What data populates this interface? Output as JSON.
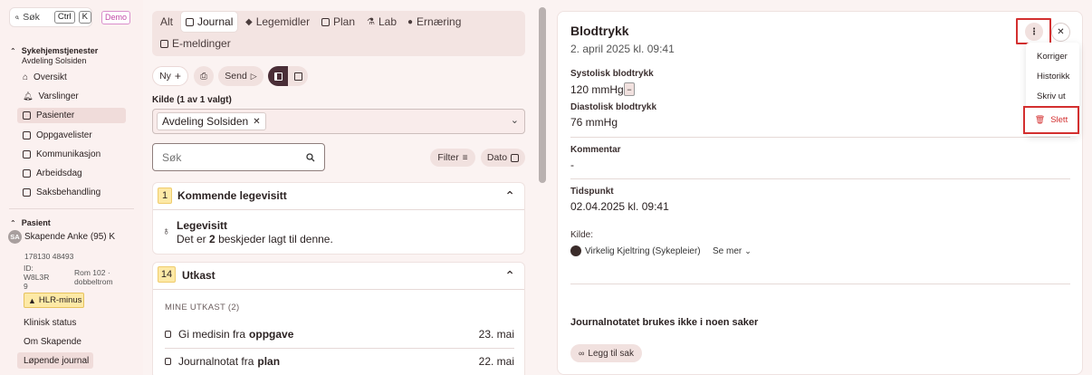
{
  "sidebar": {
    "search_label": "Søk",
    "kbd_ctrl": "Ctrl",
    "kbd_k": "K",
    "demo_badge": "Demo",
    "section_title": "Sykehjemstjenester",
    "section_sub": "Avdeling Solsiden",
    "items": [
      {
        "label": "Oversikt"
      },
      {
        "label": "Varslinger"
      },
      {
        "label": "Pasienter"
      },
      {
        "label": "Oppgavelister"
      },
      {
        "label": "Kommunikasjon"
      },
      {
        "label": "Arbeidsdag"
      },
      {
        "label": "Saksbehandling"
      }
    ],
    "patient": {
      "section_title": "Pasient",
      "initials": "SA",
      "name": "Skapende Anke (95) K",
      "ssn": "178130 48493",
      "id_line1": "ID:",
      "id_line2": "W8L3R",
      "id_line3": "9",
      "room_line1": "Rom 102 ·",
      "room_line2": "dobbeltrom",
      "alert": "HLR-minus",
      "nav": [
        {
          "label": "Klinisk status"
        },
        {
          "label": "Om Skapende"
        },
        {
          "label": "Løpende journal"
        }
      ]
    }
  },
  "tabs": [
    {
      "label": "Alt"
    },
    {
      "label": "Journal"
    },
    {
      "label": "Legemidler"
    },
    {
      "label": "Plan"
    },
    {
      "label": "Lab"
    },
    {
      "label": "Ernæring"
    },
    {
      "label": "E-meldinger"
    }
  ],
  "toolbar": {
    "new_label": "Ny",
    "send_label": "Send"
  },
  "source_filter": {
    "label": "Kilde (1 av 1 valgt)",
    "chip": "Avdeling Solsiden"
  },
  "search": {
    "placeholder": "Søk"
  },
  "filter_label": "Filter",
  "date_label": "Dato",
  "upcoming": {
    "count": "1",
    "title": "Kommende legevisitt",
    "item_title": "Legevisitt",
    "item_text_prefix": "Det er",
    "item_text_count": "2",
    "item_text_suffix": "beskjeder lagt til denne."
  },
  "drafts": {
    "count": "14",
    "title": "Utkast",
    "subheading": "MINE UTKAST (2)",
    "rows": [
      {
        "prefix": "Gi medisin fra",
        "bold": "oppgave",
        "date": "23. mai"
      },
      {
        "prefix": "Journalnotat fra",
        "bold": "plan",
        "date": "22. mai"
      }
    ]
  },
  "detail": {
    "title": "Blodtrykk",
    "datetime": "2. april 2025 kl. 09:41",
    "systolic_label": "Systolisk blodtrykk",
    "systolic_value": "120 mmHg",
    "diastolic_label": "Diastolisk blodtrykk",
    "diastolic_value": "76 mmHg",
    "comment_label": "Kommentar",
    "comment_value": "-",
    "time_label": "Tidspunkt",
    "time_value": "02.04.2025 kl. 09:41",
    "source_label": "Kilde:",
    "source_person": "Virkelig Kjeltring (Sykepleier)",
    "see_more": "Se mer",
    "cases_text": "Journalnotatet brukes ikke i noen saker",
    "add_case": "Legg til sak"
  },
  "menu": {
    "items": [
      {
        "label": "Korriger"
      },
      {
        "label": "Historikk"
      },
      {
        "label": "Skriv ut"
      }
    ],
    "delete_label": "Slett",
    "delete_color": "#d32f2f"
  }
}
